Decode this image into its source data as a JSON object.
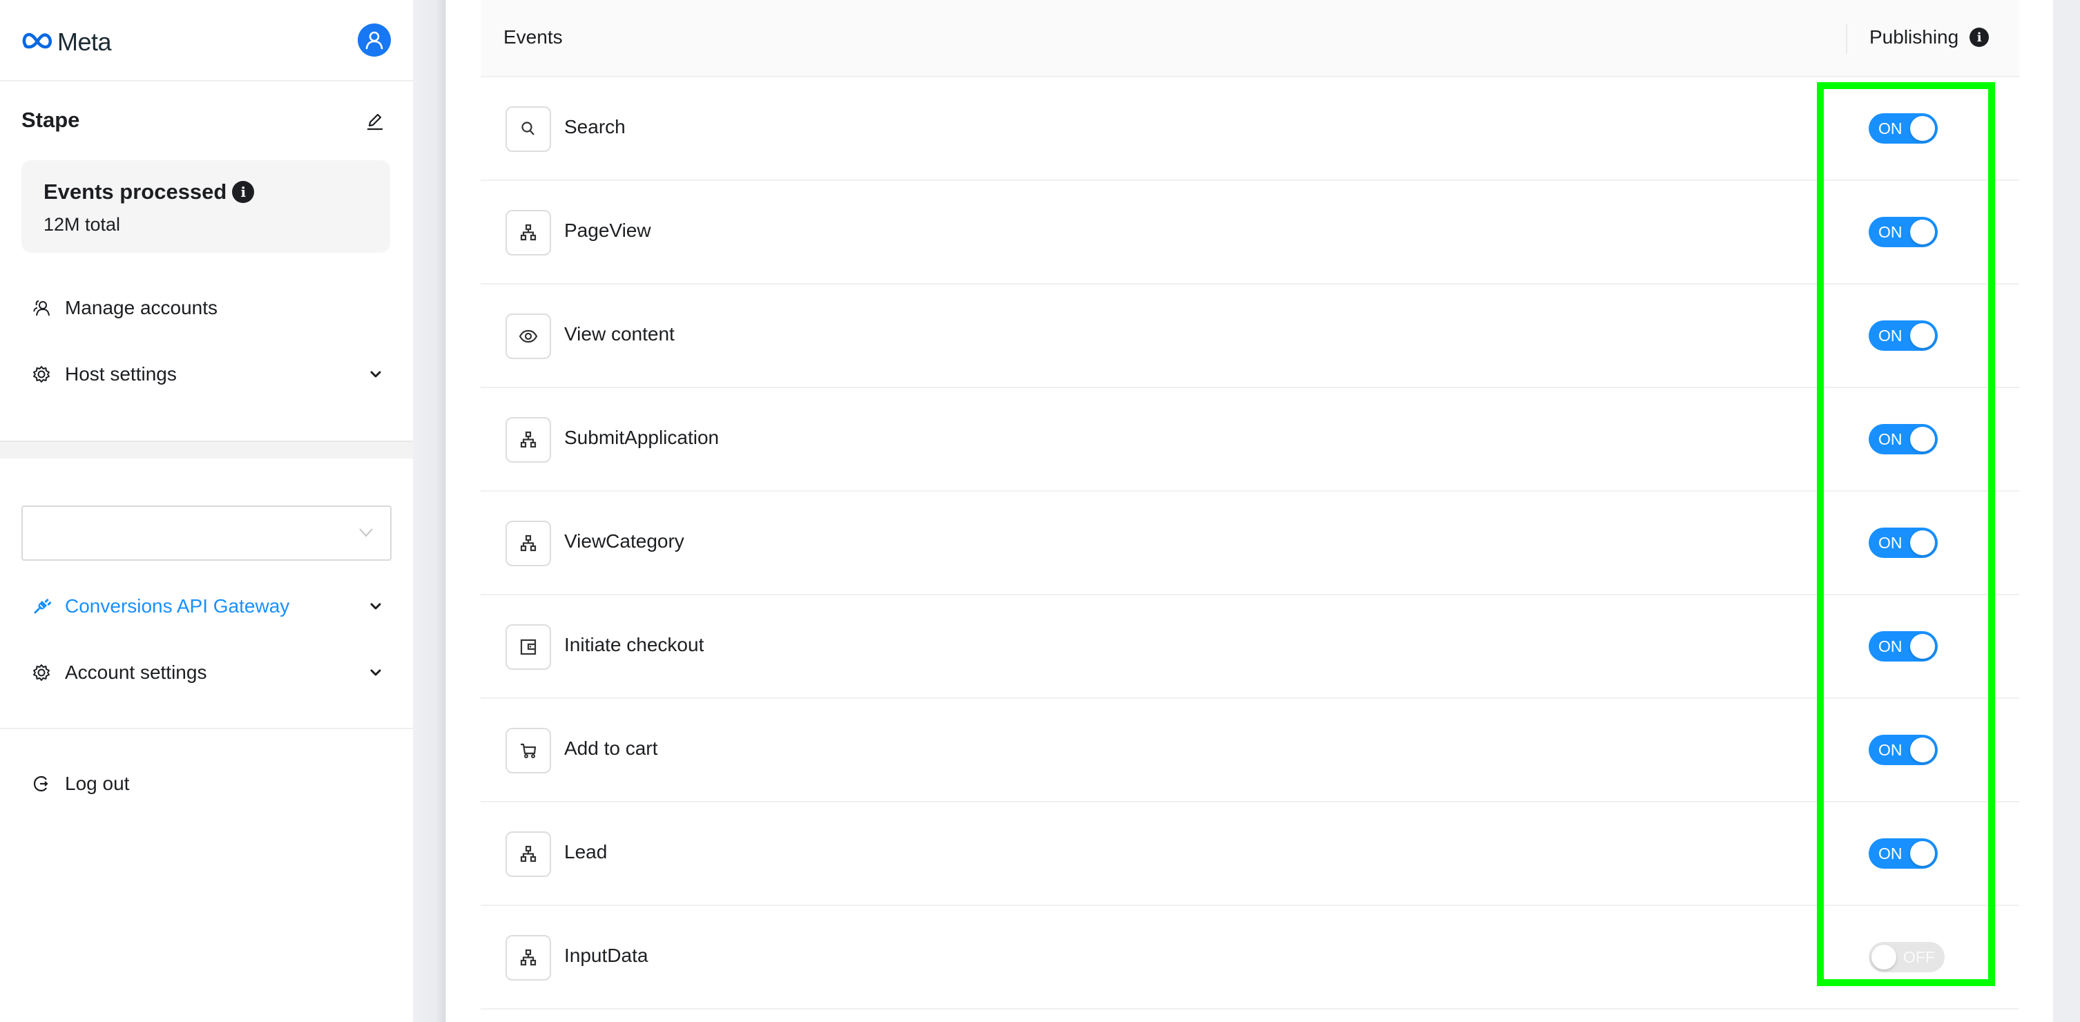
{
  "sidebar": {
    "logo_text": "Meta",
    "account_name": "Stape",
    "stats": {
      "title": "Events processed",
      "subtitle": "12M total"
    },
    "nav_top": [
      {
        "label": "Manage accounts",
        "icon": "manage-accounts-icon",
        "has_chevron": false
      },
      {
        "label": "Host settings",
        "icon": "gear-icon",
        "has_chevron": true
      }
    ],
    "select": {
      "value": ""
    },
    "nav_bottom": [
      {
        "label": "Conversions API Gateway",
        "icon": "plug-icon",
        "has_chevron": true,
        "active": true
      },
      {
        "label": "Account settings",
        "icon": "gear-icon",
        "has_chevron": true,
        "active": false
      }
    ],
    "logout_label": "Log out"
  },
  "table": {
    "col_events": "Events",
    "col_publishing": "Publishing",
    "rows": [
      {
        "name": "Search",
        "icon": "search-icon",
        "publishing": true,
        "toggle_label": "ON"
      },
      {
        "name": "PageView",
        "icon": "sitemap-icon",
        "publishing": true,
        "toggle_label": "ON"
      },
      {
        "name": "View content",
        "icon": "eye-icon",
        "publishing": true,
        "toggle_label": "ON"
      },
      {
        "name": "SubmitApplication",
        "icon": "sitemap-icon",
        "publishing": true,
        "toggle_label": "ON"
      },
      {
        "name": "ViewCategory",
        "icon": "sitemap-icon",
        "publishing": true,
        "toggle_label": "ON"
      },
      {
        "name": "Initiate checkout",
        "icon": "wallet-icon",
        "publishing": true,
        "toggle_label": "ON"
      },
      {
        "name": "Add to cart",
        "icon": "cart-icon",
        "publishing": true,
        "toggle_label": "ON"
      },
      {
        "name": "Lead",
        "icon": "sitemap-icon",
        "publishing": true,
        "toggle_label": "ON"
      },
      {
        "name": "InputData",
        "icon": "sitemap-icon",
        "publishing": false,
        "toggle_label": "OFF"
      }
    ]
  },
  "colors": {
    "accent": "#1890ff",
    "brand": "#1877f2",
    "toggle_off": "#e6e6e6",
    "highlight": "#00ff00"
  }
}
